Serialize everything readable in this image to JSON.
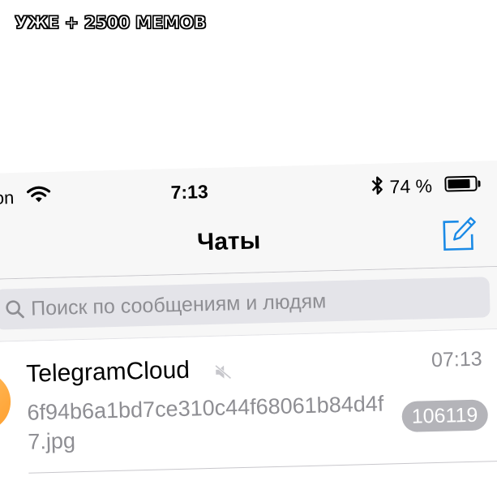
{
  "caption": "УЖЕ + 2500 МЕМОВ",
  "status_bar": {
    "carrier": "on",
    "time": "7:13",
    "bluetooth_glyph": "✱",
    "battery_percent": "74 %",
    "battery_level": 0.74,
    "icons": [
      "wifi-icon",
      "bluetooth-icon",
      "battery-icon"
    ]
  },
  "nav": {
    "title": "Чаты",
    "compose_icon": "compose-icon"
  },
  "search": {
    "placeholder": "Поиск по сообщениям и людям",
    "icon": "search-icon"
  },
  "chats": [
    {
      "name": "TelegramCloud",
      "muted": true,
      "time": "07:13",
      "preview": "6f94b6a1bd7ce310c44f68061b84d4f7.jpg",
      "unread": "106119"
    }
  ],
  "colors": {
    "accent": "#1a8ae6",
    "bar_bg": "#f7f7f7",
    "secondary_text": "#8e8e93",
    "badge_muted": "#b4b4b9",
    "avatar": "#ffb04a"
  }
}
